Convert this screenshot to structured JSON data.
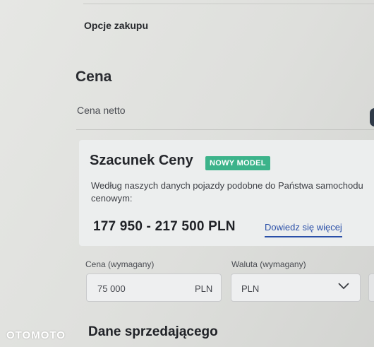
{
  "header": {
    "purchase_options": "Opcje zakupu"
  },
  "price_section": {
    "title": "Cena",
    "net_price_label": "Cena netto"
  },
  "estimate": {
    "title": "Szacunek Ceny",
    "badge": "NOWY MODEL",
    "desc_line1": "Według naszych danych pojazdy podobne do Państwa samochodu",
    "desc_line2": "cenowym:",
    "range": "177 950 - 217 500 PLN",
    "learn_more": "Dowiedz się więcej"
  },
  "form": {
    "price_label": "Cena (wymagany)",
    "price_value": "75 000",
    "price_unit": "PLN",
    "currency_label": "Waluta (wymagany)",
    "currency_value": "PLN"
  },
  "seller": {
    "title": "Dane sprzedającego"
  },
  "watermark": "OTOMOTO",
  "colors": {
    "badge": "#3cb38a",
    "link": "#2a4fa8",
    "toggle": "#2f3a48"
  }
}
